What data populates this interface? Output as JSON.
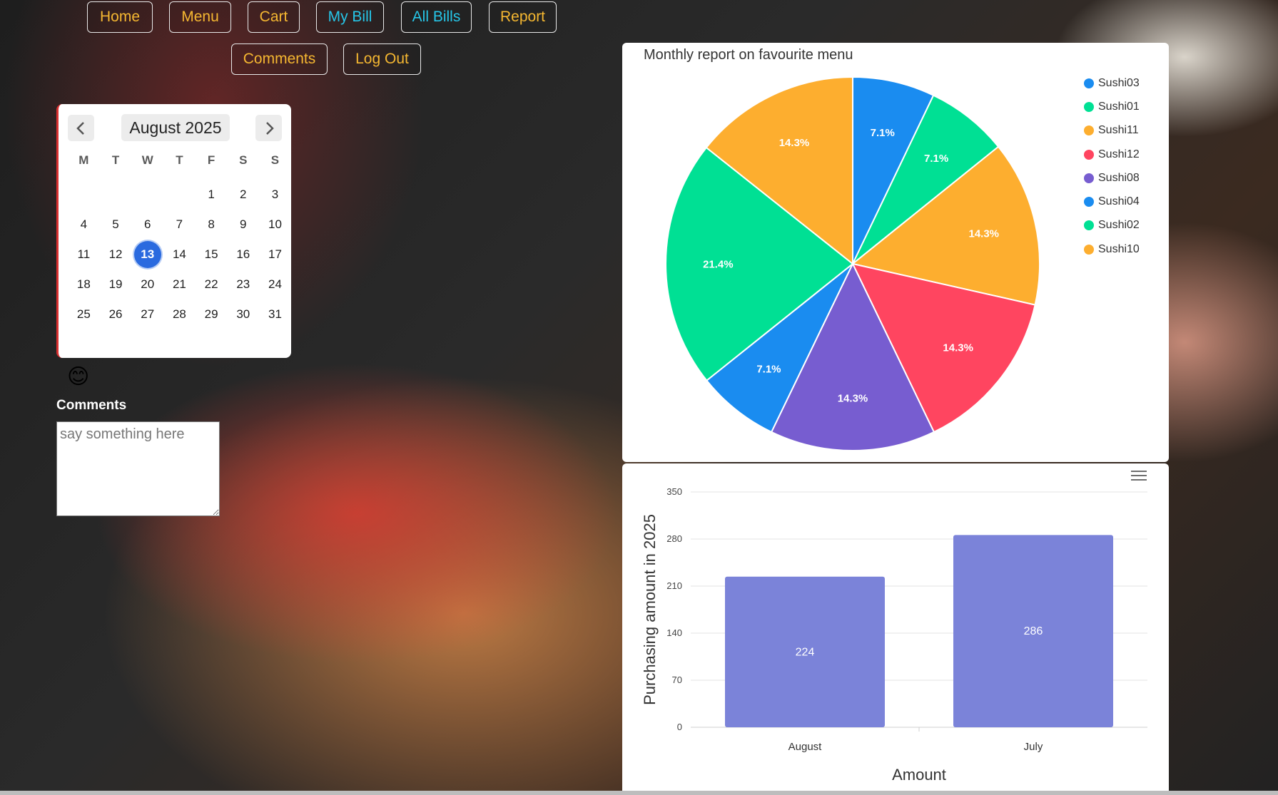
{
  "nav": {
    "row1": [
      {
        "label": "Home",
        "color": "gold"
      },
      {
        "label": "Menu",
        "color": "gold"
      },
      {
        "label": "Cart",
        "color": "gold"
      },
      {
        "label": "My Bill",
        "color": "cyan"
      },
      {
        "label": "All Bills",
        "color": "cyan"
      },
      {
        "label": "Report",
        "color": "gold"
      }
    ],
    "row2": [
      {
        "label": "Comments",
        "color": "gold"
      },
      {
        "label": "Log Out",
        "color": "gold"
      }
    ]
  },
  "calendar": {
    "month_label": "August 2025",
    "weekdays": [
      "M",
      "T",
      "W",
      "T",
      "F",
      "S",
      "S"
    ],
    "first_weekday_offset": 4,
    "days_in_month": 31,
    "selected_day": 13,
    "prev_icon": "chevron-left-icon",
    "next_icon": "chevron-right-icon"
  },
  "comments": {
    "emoji": "😊",
    "label": "Comments",
    "placeholder": "say something here"
  },
  "colors": {
    "nav_gold": "#f5b731",
    "nav_cyan": "#26c6e8",
    "today": "#2a6adf",
    "bar": "#7b83d9"
  },
  "chart_data": [
    {
      "type": "pie",
      "title": "Monthly report on favourite menu",
      "legend_position": "right",
      "slices": [
        {
          "label": "Sushi03",
          "value": 7.1,
          "color": "#1a8cf0"
        },
        {
          "label": "Sushi01",
          "value": 7.1,
          "color": "#00e094"
        },
        {
          "label": "Sushi11",
          "value": 14.3,
          "color": "#fdae2f"
        },
        {
          "label": "Sushi12",
          "value": 14.3,
          "color": "#ff4560"
        },
        {
          "label": "Sushi08",
          "value": 14.3,
          "color": "#775dd0"
        },
        {
          "label": "Sushi04",
          "value": 7.1,
          "color": "#1a8cf0"
        },
        {
          "label": "Sushi02",
          "value": 21.4,
          "color": "#00e094"
        },
        {
          "label": "Sushi10",
          "value": 14.3,
          "color": "#fdae2f"
        }
      ]
    },
    {
      "type": "bar",
      "categories": [
        "August",
        "July"
      ],
      "values": [
        224,
        286
      ],
      "xlabel": "Amount",
      "ylabel": "Purchasing amount in 2025",
      "ylim": [
        0,
        350
      ],
      "yticks": [
        0,
        70,
        140,
        210,
        280,
        350
      ],
      "grid": true,
      "color": "#7b83d9"
    }
  ]
}
